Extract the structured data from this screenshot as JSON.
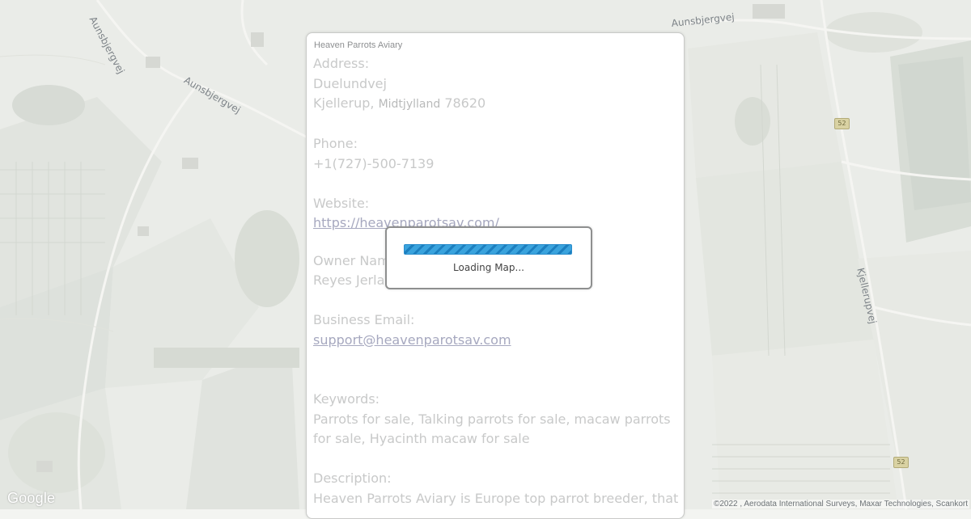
{
  "map": {
    "road_labels": [
      "Aunsbjergvej",
      "Aunsbjergvej",
      "Aunsbjergvej",
      "Kjellerupvej"
    ],
    "route_shields": [
      "52",
      "52"
    ],
    "google_logo": "Google",
    "attribution": "©2022 , Aerodata International Surveys, Maxar Technologies, Scankort"
  },
  "panel": {
    "title": "Heaven Parrots Aviary",
    "address_label": "Address:",
    "street": "Duelundvej",
    "city": "Kjellerup,",
    "region": "Midtjylland",
    "postal_code": "78620",
    "phone_label": "Phone:",
    "phone": "+1(727)-500-7139",
    "website_label": "Website:",
    "website": "https://heavenparotsav.com/",
    "owner_label": "Owner Name:",
    "owner": "Reyes Jerla",
    "email_label": "Business Email:",
    "email": "support@heavenparotsav.com",
    "keywords_label": "Keywords:",
    "keywords": "Parrots for sale, Talking parrots for sale, macaw parrots for sale, Hyacinth macaw for sale",
    "description_label": "Description:",
    "description": "Heaven Parrots Aviary is Europe top parrot breeder, that"
  },
  "loading": {
    "text": "Loading Map..."
  }
}
